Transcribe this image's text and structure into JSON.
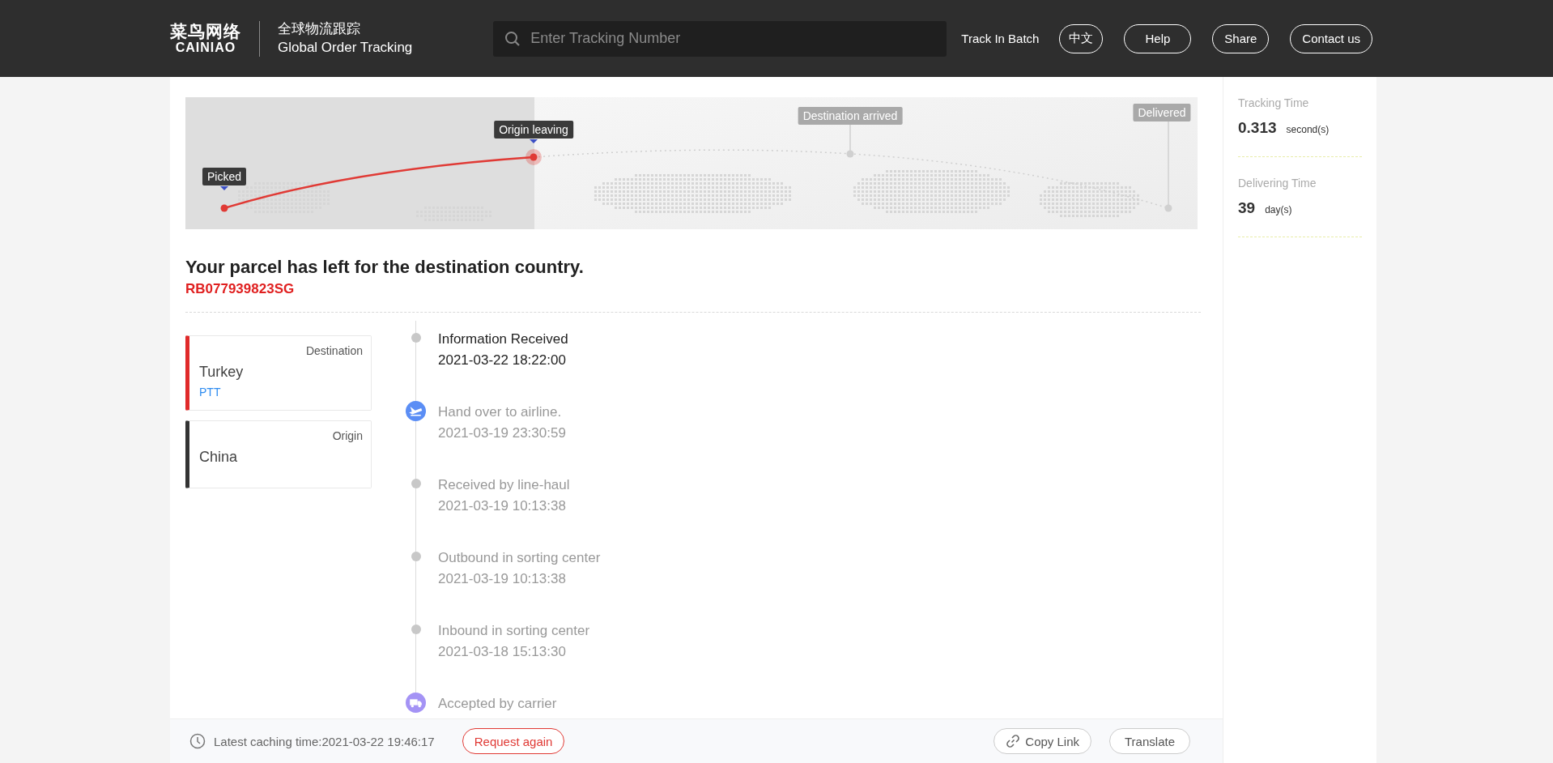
{
  "header": {
    "logo_cn": "菜鸟网络",
    "logo_en": "CAINIAO",
    "title_cn": "全球物流跟踪",
    "title_en": "Global Order Tracking",
    "search": {
      "placeholder": "Enter Tracking Number"
    },
    "batch_link": "Track In Batch",
    "buttons": [
      "中文",
      "Help",
      "Share",
      "Contact us"
    ]
  },
  "map": {
    "milestones": [
      {
        "label": "Picked",
        "reached": true
      },
      {
        "label": "Origin leaving",
        "reached": true
      },
      {
        "label": "Destination arrived",
        "reached": false
      },
      {
        "label": "Delivered",
        "reached": false
      }
    ]
  },
  "summary": {
    "status": "Your parcel has left for the destination country.",
    "tracking_number": "RB077939823SG"
  },
  "places": [
    {
      "kind": "destination",
      "caption": "Destination",
      "country": "Turkey",
      "carrier": "PTT"
    },
    {
      "kind": "origin",
      "caption": "Origin",
      "country": "China"
    }
  ],
  "timeline": [
    {
      "kind": "dot",
      "latest": true,
      "event": "Information Received",
      "time": "2021-03-22 18:22:00"
    },
    {
      "kind": "plane",
      "latest": false,
      "event": "Hand over to airline.",
      "time": "2021-03-19 23:30:59"
    },
    {
      "kind": "dot",
      "latest": false,
      "event": "Received by line-haul",
      "time": "2021-03-19 10:13:38"
    },
    {
      "kind": "dot",
      "latest": false,
      "event": "Outbound in sorting center",
      "time": "2021-03-19 10:13:38"
    },
    {
      "kind": "dot",
      "latest": false,
      "event": "Inbound in sorting center",
      "time": "2021-03-18 15:13:30"
    },
    {
      "kind": "truck",
      "latest": false,
      "event": "Accepted by carrier"
    }
  ],
  "side": [
    {
      "label": "Tracking Time",
      "value": "0.313",
      "unit": "second(s)"
    },
    {
      "label": "Delivering Time",
      "value": "39",
      "unit": "day(s)"
    }
  ],
  "footer": {
    "cache_text": "Latest caching time:2021-03-22 19:46:17",
    "request_button": "Request again",
    "copy_button": "Copy Link",
    "translate_button": "Translate"
  }
}
